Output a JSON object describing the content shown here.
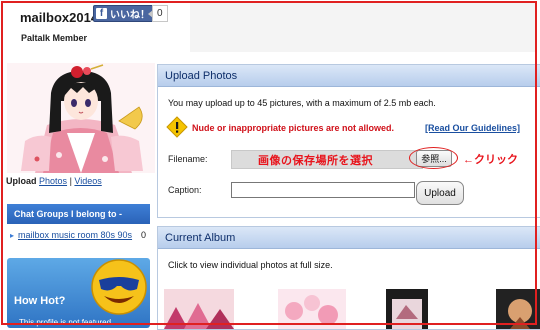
{
  "profile": {
    "username": "mailbox2014",
    "role": "Paltalk Member",
    "fb_like_label": "いいね！",
    "fb_like_count": "0"
  },
  "sidebar": {
    "upload_label": "Upload",
    "photos_link": "Photos",
    "separator": "|",
    "videos_link": "Videos",
    "chat_groups_header": "Chat Groups I belong to -",
    "chat_groups": [
      {
        "name": "mailbox music room 80s 90s",
        "count": "0"
      }
    ],
    "how_hot_title": "How Hot?",
    "how_hot_sub": "This profile is not featured"
  },
  "upload_panel": {
    "title": "Upload Photos",
    "info": "You may upload up to 45 pictures, with a maximum of 2.5 mb each.",
    "warning": "Nude or inappropriate pictures are not allowed.",
    "guidelines_link": "[Read Our Guidelines]",
    "filename_label": "Filename:",
    "browse_button": "参照...",
    "caption_label": "Caption:",
    "upload_button": "Upload",
    "annotation_location": "画像の保存場所を選択",
    "annotation_click": "←クリック"
  },
  "album_panel": {
    "title": "Current Album",
    "instruction": "Click to view individual photos at full size."
  },
  "colors": {
    "annotation_red": "#e8141c",
    "panel_header": "#b7cdec",
    "link_blue": "#1a4fa0",
    "sidebar_blue": "#2a63b8"
  }
}
